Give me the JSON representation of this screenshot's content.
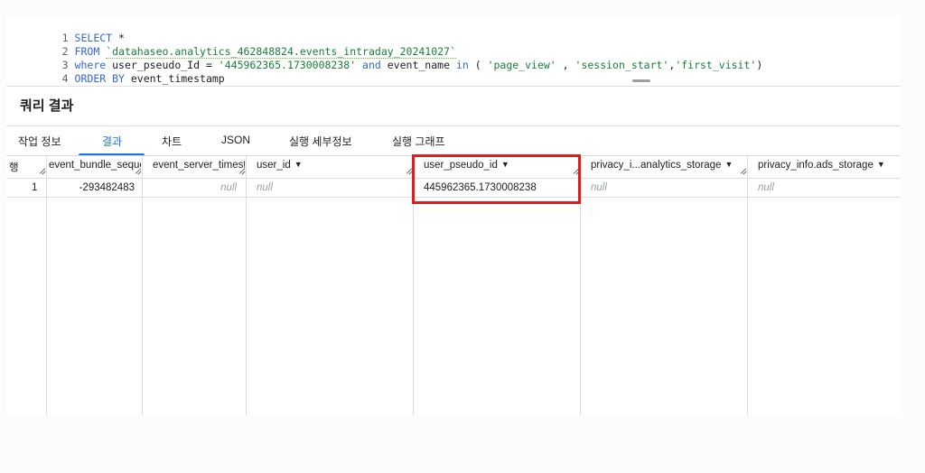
{
  "editor": {
    "lines": [
      {
        "num": "1",
        "kw1": "SELECT",
        "rest": " *"
      },
      {
        "num": "2",
        "kw1": "FROM",
        "table": "`datahaseo.analytics_462848824.events_intraday_20241027`"
      },
      {
        "num": "3",
        "kw1": "where",
        "field1": " user_pseudo_Id = ",
        "val1": "'445962365.1730008238'",
        "kw2": " and",
        "field2": " event_name ",
        "kw3": "in",
        "paren": " ( ",
        "val2": "'page_view'",
        "comma1": " , ",
        "val3": "'session_start'",
        "comma2": ",",
        "val4": "'first_visit'",
        "close": ")"
      },
      {
        "num": "4",
        "kw1": "ORDER BY",
        "rest": " event_timestamp"
      }
    ]
  },
  "results": {
    "title": "쿼리 결과",
    "tabs": [
      "작업 정보",
      "결과",
      "차트",
      "JSON",
      "실행 세부정보",
      "실행 그래프"
    ],
    "active_tab": "결과"
  },
  "grid": {
    "row_header": "행",
    "columns": [
      "event_bundle_sequer",
      "event_server_timesta",
      "user_id",
      "user_pseudo_id",
      "privacy_i...analytics_storage",
      "privacy_info.ads_storage"
    ],
    "rows": [
      {
        "index": "1",
        "cells": [
          "-293482483",
          "null",
          "null",
          "445962365.1730008238",
          "null",
          "null"
        ]
      }
    ]
  },
  "colors": {
    "accent": "#1a73e8",
    "highlight": "#e21c1c"
  }
}
